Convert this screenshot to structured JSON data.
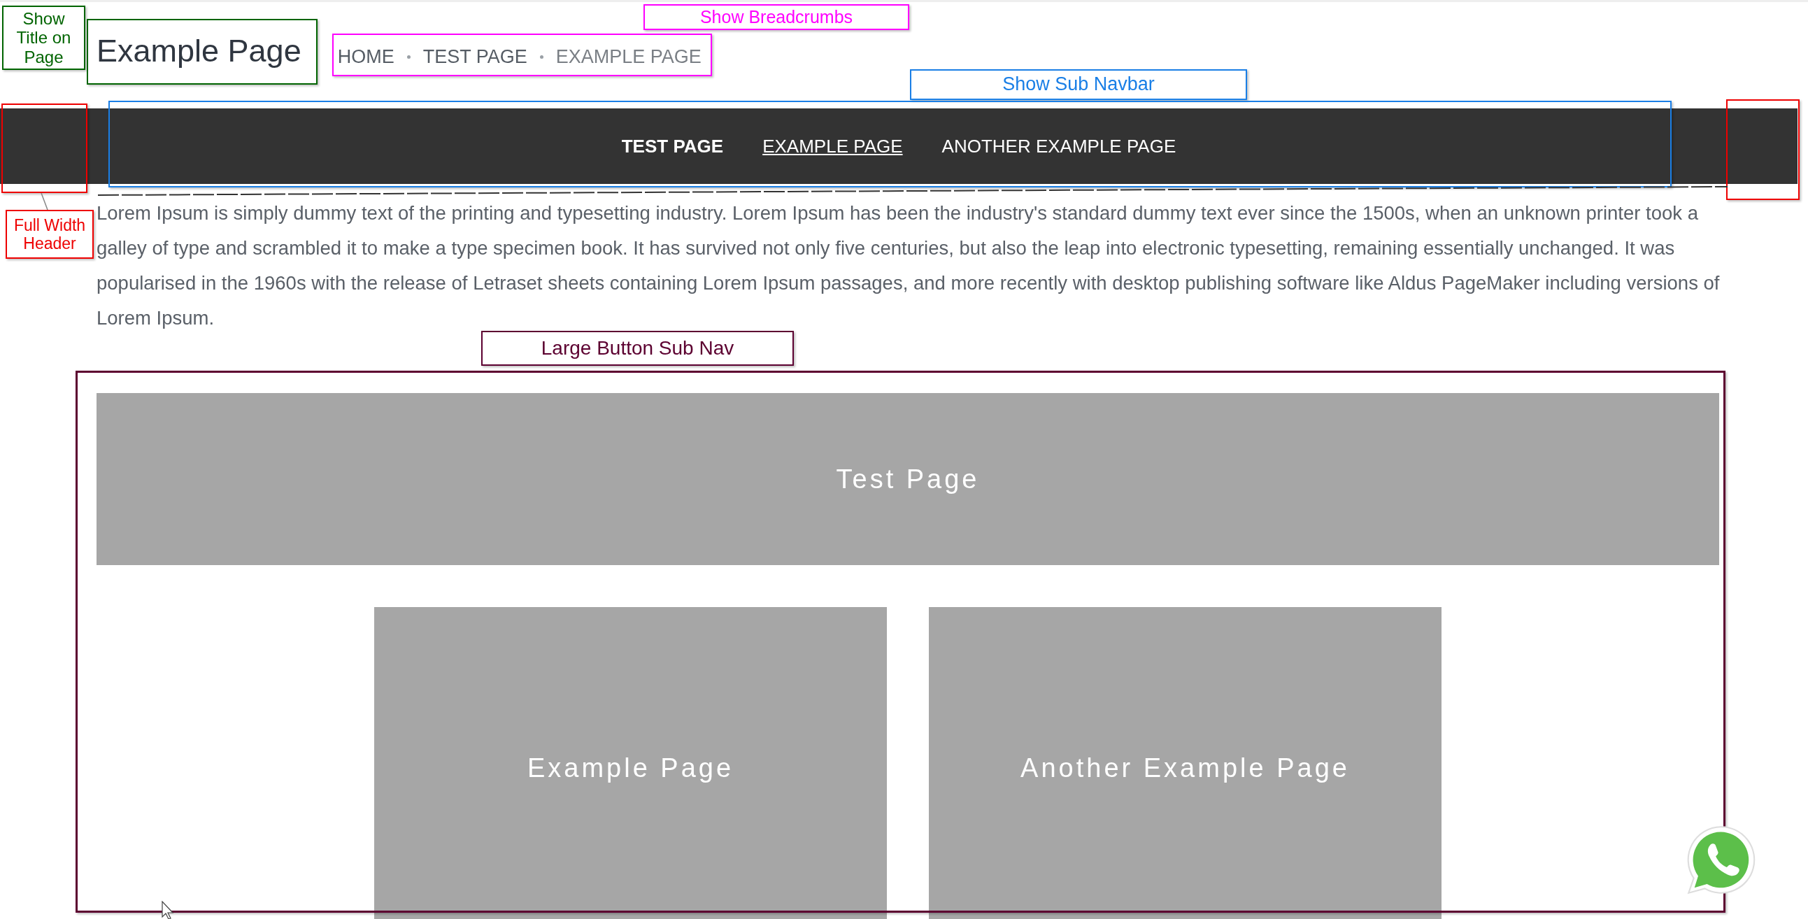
{
  "page": {
    "title": "Example Page",
    "breadcrumbs": [
      {
        "label": "HOME",
        "current": false
      },
      {
        "label": "TEST PAGE",
        "current": false
      },
      {
        "label": "EXAMPLE PAGE",
        "current": true
      }
    ],
    "sub_navbar": [
      {
        "label": "TEST PAGE",
        "kind": "parent"
      },
      {
        "label": "EXAMPLE PAGE",
        "kind": "current"
      },
      {
        "label": "ANOTHER EXAMPLE PAGE",
        "kind": "link"
      }
    ],
    "paragraph": "Lorem Ipsum is simply dummy text of the printing and typesetting industry. Lorem Ipsum has been the industry's standard dummy text ever since the 1500s, when an unknown printer took a galley of type and scrambled it to make a type specimen book. It has survived not only five centuries, but also the leap into electronic typesetting, remaining essentially unchanged. It was popularised in the 1960s with the release of Letraset sheets containing Lorem Ipsum passages, and more recently with desktop publishing software like Aldus PageMaker including versions of Lorem Ipsum.",
    "large_buttons": [
      {
        "label": "Test Page",
        "kind": "wide"
      },
      {
        "label": "Example Page",
        "kind": "half"
      },
      {
        "label": "Another Example Page",
        "kind": "half"
      }
    ]
  },
  "annotations": [
    {
      "label": "Show Title on Page",
      "color": "#006400"
    },
    {
      "label": "Show Breadcrumbs",
      "color": "#ff00ff"
    },
    {
      "label": "Show Sub Navbar",
      "color": "#1a7fe6"
    },
    {
      "label": "Full Width Header",
      "color": "#ee0000"
    },
    {
      "label": "Large Button Sub Nav",
      "color": "#5c0030"
    }
  ]
}
